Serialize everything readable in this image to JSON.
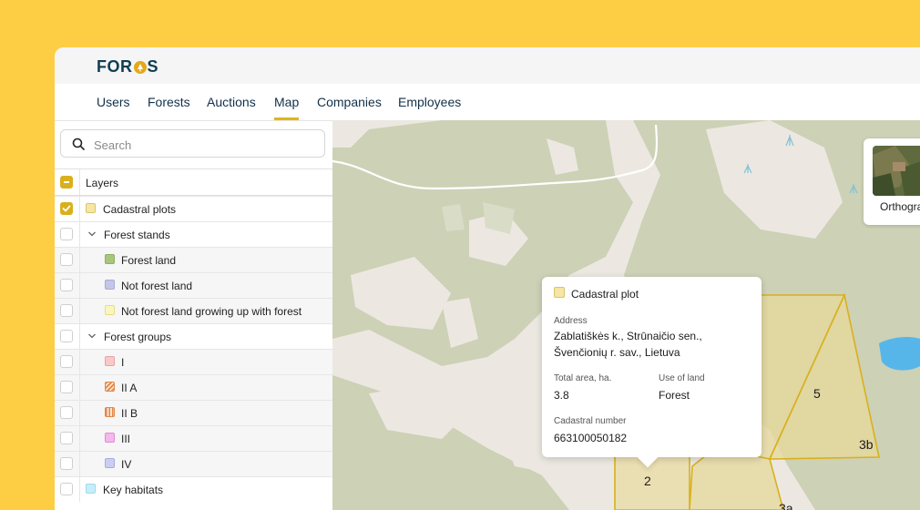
{
  "app": {
    "logo": "FOROS",
    "logo_left": "FOR",
    "logo_right": "S"
  },
  "nav": {
    "items": [
      "Users",
      "Forests",
      "Auctions",
      "Map",
      "Companies",
      "Employees"
    ],
    "active": "Map"
  },
  "search": {
    "placeholder": "Search",
    "value": ""
  },
  "layers": {
    "header": "Layers",
    "header_state": "partial",
    "rows": [
      {
        "label": "Cadastral plots",
        "checked": true,
        "swatch": "#f7e6a3"
      },
      {
        "label": "Forest stands",
        "checked": false,
        "expandable": true
      },
      {
        "label": "Forest land",
        "checked": false,
        "swatch": "#a8c67e"
      },
      {
        "label": "Not forest land",
        "checked": false,
        "swatch": "#c4c6e8"
      },
      {
        "label": "Not forest land growing up with forest",
        "checked": false,
        "swatch": "#fbf6bd"
      },
      {
        "label": "Forest groups",
        "checked": false,
        "expandable": true
      },
      {
        "label": "I",
        "checked": false,
        "swatch": "#f8c9c9"
      },
      {
        "label": "II A",
        "checked": false,
        "swatch": "hatched-orange"
      },
      {
        "label": "II B",
        "checked": false,
        "swatch": "striped-orange"
      },
      {
        "label": "III",
        "checked": false,
        "swatch": "#f5b7ee"
      },
      {
        "label": "IV",
        "checked": false,
        "swatch": "#cbcdf3"
      },
      {
        "label": "Key habitats",
        "checked": false,
        "swatch": "#c6eefa"
      }
    ]
  },
  "map": {
    "basemap_toggle": "Orthogra",
    "plot_labels": [
      "5",
      "3b",
      "3a",
      "2"
    ],
    "popup": {
      "title": "Cadastral plot",
      "address_label": "Address",
      "address_line1": "Zablatiškės k., Strūnaičio sen.,",
      "address_line2": "Švenčionių r. sav., Lietuva",
      "area_label": "Total area, ha.",
      "area_value": "3.8",
      "use_label": "Use of land",
      "use_value": "Forest",
      "cadastral_label": "Cadastral number",
      "cadastral_value": "663100050182"
    }
  },
  "colors": {
    "background": "#fdcd44",
    "accent": "#d9b01c",
    "nav_text": "#12304a",
    "map_forest": "#cdd1b6",
    "map_open": "#ece8e1",
    "plot_fill": "#e6d89a",
    "plot_border": "#d9b01c",
    "water": "#56b6e9"
  }
}
